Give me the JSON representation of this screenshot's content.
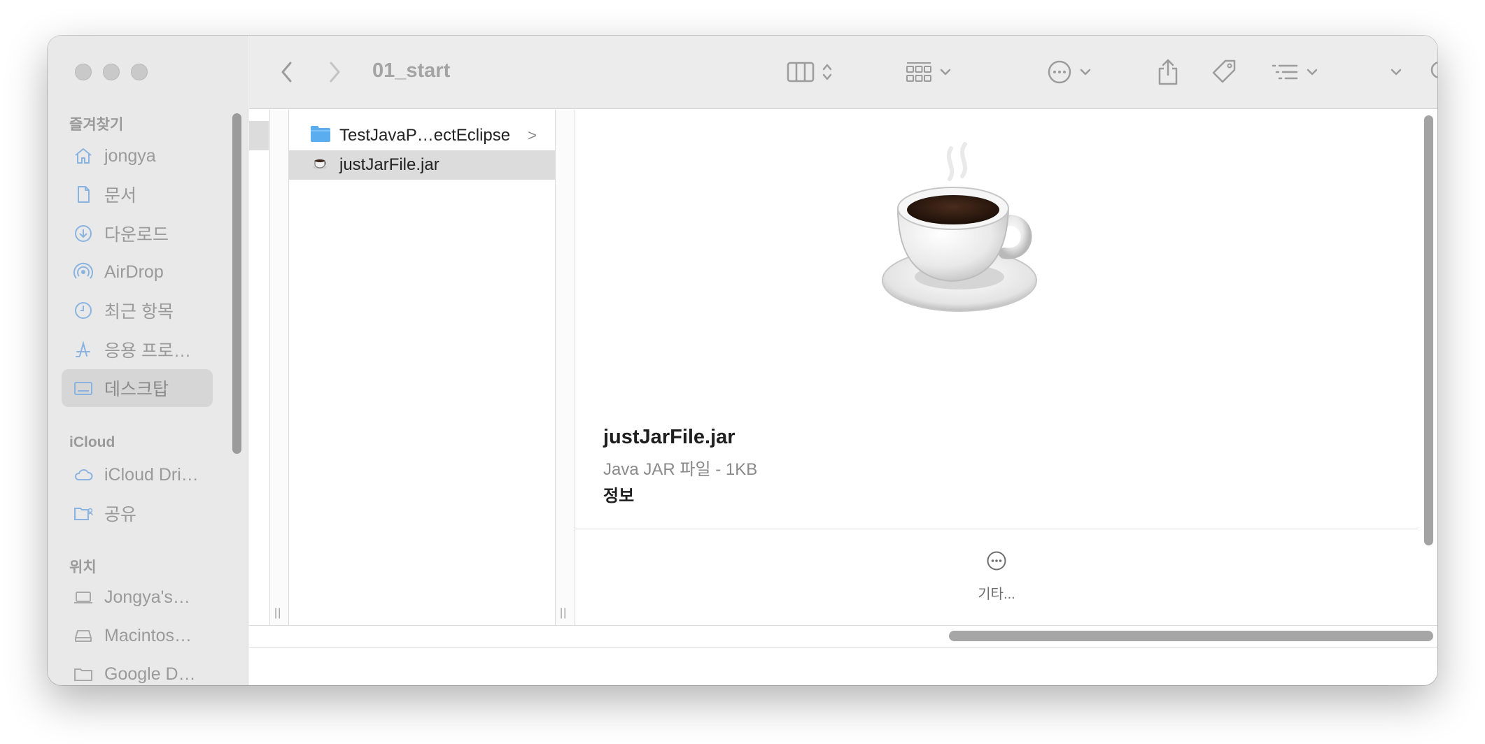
{
  "window": {
    "title": "01_start"
  },
  "sidebar": {
    "sections": {
      "favorites": "즐겨찾기",
      "icloud": "iCloud",
      "locations": "위치"
    },
    "favorites": [
      {
        "label": "jongya",
        "icon": "house-icon"
      },
      {
        "label": "문서",
        "icon": "document-icon"
      },
      {
        "label": "다운로드",
        "icon": "download-icon"
      },
      {
        "label": "AirDrop",
        "icon": "airdrop-icon"
      },
      {
        "label": "최근 항목",
        "icon": "clock-icon"
      },
      {
        "label": "응용 프로…",
        "icon": "applications-icon"
      },
      {
        "label": "데스크탑",
        "icon": "desktop-icon",
        "selected": true
      }
    ],
    "icloud": [
      {
        "label": "iCloud Dri…",
        "icon": "cloud-icon"
      },
      {
        "label": "공유",
        "icon": "shared-folder-icon"
      }
    ],
    "locations": [
      {
        "label": "Jongya's…",
        "icon": "laptop-icon"
      },
      {
        "label": "Macintos…",
        "icon": "disk-icon"
      },
      {
        "label": "Google D…",
        "icon": "folder-icon"
      }
    ]
  },
  "toolbar": {
    "icons": [
      "back-icon",
      "forward-icon",
      "column-view-icon",
      "group-icon",
      "more-icon",
      "share-icon",
      "tag-icon",
      "sort-icon",
      "expand-icon",
      "search-icon"
    ]
  },
  "files": [
    {
      "name": "TestJavaP…ectEclipse",
      "type": "folder",
      "has_children": true,
      "chevron": ">"
    },
    {
      "name": "justJarFile.jar",
      "type": "jar",
      "selected": true
    }
  ],
  "preview": {
    "name": "justJarFile.jar",
    "kind": "Java JAR 파일 - 1KB",
    "info_heading": "정보",
    "more_label": "기타..."
  },
  "colors": {
    "sidebar_bg": "#e9e9e9",
    "toolbar_bg": "#ececec",
    "selection": "#dcdcdc",
    "folder_blue": "#5aaef0"
  }
}
